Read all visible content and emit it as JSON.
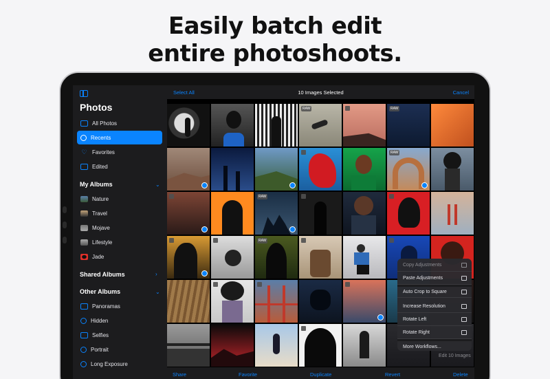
{
  "headline": {
    "line1": "Easily batch edit",
    "line2": "entire photoshoots."
  },
  "sidebar": {
    "title": "Photos",
    "library_items": [
      {
        "label": "All Photos",
        "icon": "photos-icon"
      },
      {
        "label": "Recents",
        "icon": "clock-icon",
        "active": true
      },
      {
        "label": "Favorites",
        "icon": "heart-icon"
      },
      {
        "label": "Edited",
        "icon": "edited-icon"
      }
    ],
    "my_albums": {
      "label": "My Albums",
      "items": [
        "Nature",
        "Travel",
        "Mojave",
        "Lifestyle",
        "Jade"
      ]
    },
    "shared_albums": {
      "label": "Shared Albums"
    },
    "other_albums": {
      "label": "Other Albums",
      "items": [
        "Panoramas",
        "Hidden",
        "Selfies",
        "Portrait",
        "Long Exposure"
      ]
    }
  },
  "topbar": {
    "select_all": "Select All",
    "selected_count": "10 Images Selected",
    "cancel": "Cancel"
  },
  "grid": {
    "raw_label": "RAW"
  },
  "menu": {
    "items": [
      {
        "label": "Copy Adjustments",
        "disabled": true
      },
      {
        "label": "Paste Adjustments",
        "disabled": false
      },
      {
        "label": "Auto Crop to Square",
        "disabled": false
      },
      {
        "label": "Increase Resolution",
        "disabled": false
      },
      {
        "label": "Rotate Left",
        "disabled": false
      },
      {
        "label": "Rotate Right",
        "disabled": false
      },
      {
        "label": "More Workflows...",
        "disabled": false
      }
    ],
    "edit_label": "Edit 10 Images"
  },
  "bottombar": {
    "share": "Share",
    "favorite": "Favorite",
    "duplicate": "Duplicate",
    "revert": "Revert",
    "delete": "Delete"
  },
  "colors": {
    "accent": "#0a84ff",
    "sidebar_bg": "#1c1c1e",
    "page_bg": "#f5f5f7"
  }
}
